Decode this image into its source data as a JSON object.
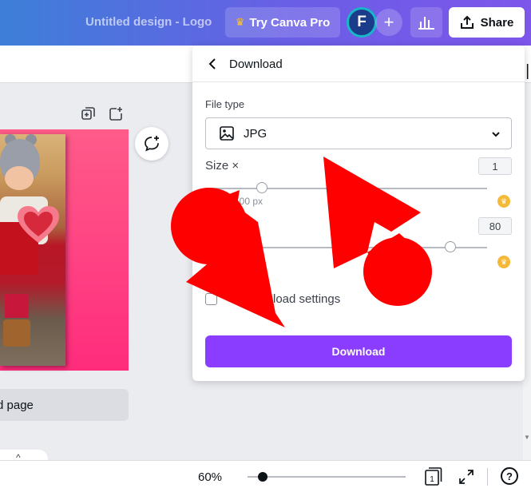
{
  "topbar": {
    "doc_title": "Untitled design - Logo",
    "pro_label": "Try Canva Pro",
    "avatar_letter": "F",
    "plus": "+",
    "share_label": "Share"
  },
  "canvas": {
    "add_page_label": "Add page",
    "add_page_visible": "d page"
  },
  "footer": {
    "zoom": "60%",
    "page_count": "1",
    "help": "?"
  },
  "panel": {
    "title": "Download",
    "file_type_label": "File type",
    "file_type_value": "JPG",
    "size_label": "Size ×",
    "size_value": "1",
    "size_px_visible": "500 px",
    "quality_label_visible": "y",
    "quality_value": "80",
    "size_slider_fraction": 0.2,
    "quality_slider_fraction": 0.87,
    "save_settings_visible": "load settings",
    "download_button": "Download"
  },
  "colors": {
    "accent": "#8b3dff",
    "canvas_pink": "#ff2c7c",
    "arrow_red": "#ff0000",
    "crown_gold": "#f5b93a"
  },
  "icons": [
    "crown-icon",
    "stats-icon",
    "share-icon",
    "duplicate-page-icon",
    "add-page-icon",
    "add-comment-icon",
    "back-chevron-icon",
    "image-icon",
    "chevron-down-icon",
    "pages-icon",
    "fullscreen-icon",
    "help-icon"
  ]
}
